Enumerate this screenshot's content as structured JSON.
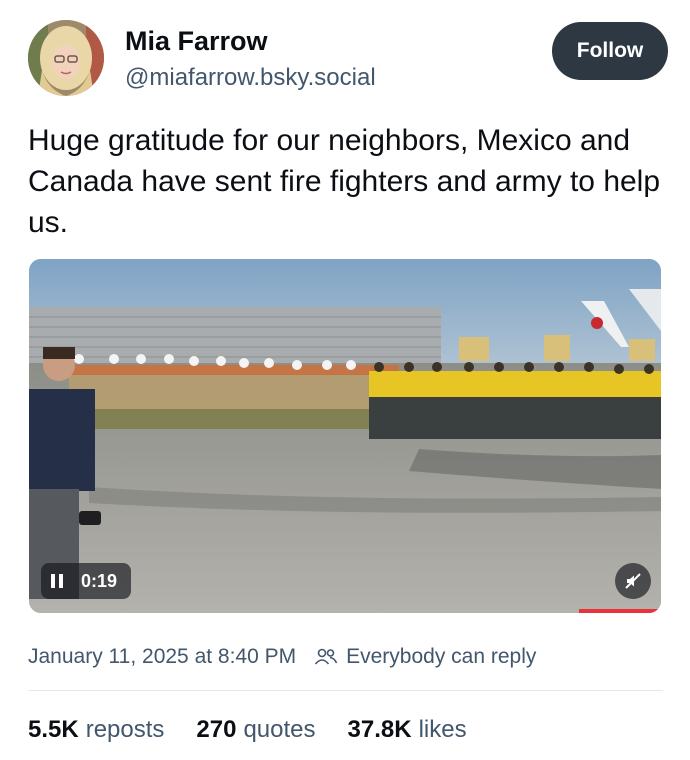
{
  "author": {
    "display_name": "Mia Farrow",
    "handle": "@miafarrow.bsky.social",
    "follow_label": "Follow"
  },
  "post": {
    "text": "Huge gratitude for our neighbors, Mexico and Canada have sent fire fighters and army to help us.",
    "timestamp": "January 11, 2025 at 8:40 PM",
    "reply_setting": "Everybody can reply"
  },
  "video": {
    "time": "0:19",
    "progress_remaining": 0.13,
    "paused": false,
    "muted": true
  },
  "stats": {
    "reposts_count": "5.5K",
    "reposts_label": "reposts",
    "quotes_count": "270",
    "quotes_label": "quotes",
    "likes_count": "37.8K",
    "likes_label": "likes"
  },
  "colors": {
    "follow_bg": "#2d3843",
    "muted_text": "#42576c",
    "progress": "#e8333a"
  },
  "icons": {
    "avatar": "avatar-photo",
    "pause": "pause-icon",
    "mute": "muted-speaker-icon",
    "reply_setting": "people-icon"
  }
}
